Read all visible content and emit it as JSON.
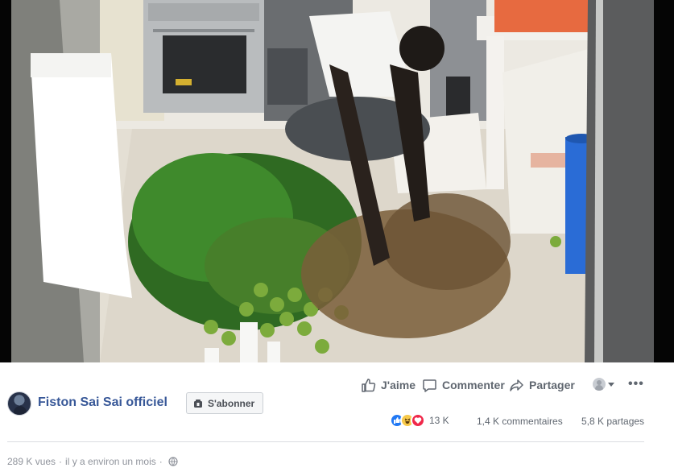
{
  "video": {
    "description_icon": "video-frame"
  },
  "post": {
    "page_name": "Fiston Sai Sai officiel",
    "subscribe_label": "S'abonner",
    "subscribe_icon": "subscribe-icon",
    "actions": {
      "like_label": "J'aime",
      "comment_label": "Commenter",
      "share_label": "Partager"
    },
    "more_label": "•••",
    "stats": {
      "reactions_count": "13 K",
      "comments": "1,4 K commentaires",
      "shares": "5,8 K partages"
    },
    "meta": {
      "views": "289 K vues",
      "separator": "·",
      "time": "il y a environ un mois",
      "separator2": "·"
    }
  },
  "colors": {
    "link": "#385898",
    "muted": "#606770",
    "like_blue": "#2078f4",
    "haha_yellow": "#f7c94a",
    "love_red": "#f0284a"
  }
}
